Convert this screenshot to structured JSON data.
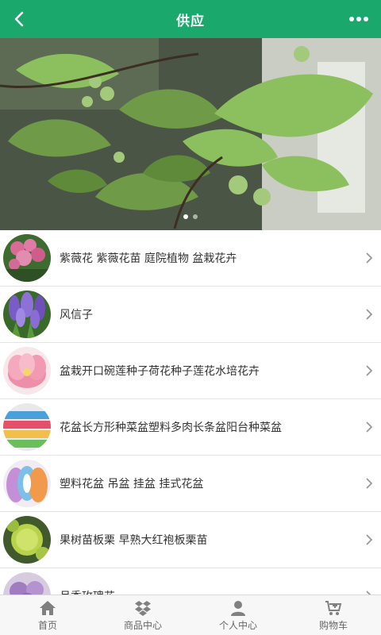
{
  "header": {
    "title": "供应",
    "back_icon": "chevron-left-icon",
    "more_icon": "more-dots-icon"
  },
  "banner": {
    "slide_count": 2,
    "active_slide": 1
  },
  "products": [
    {
      "name": "紫薇花 紫薇花苗 庭院植物 盆栽花卉"
    },
    {
      "name": "风信子"
    },
    {
      "name": "盆栽开口碗莲种子荷花种子莲花水培花卉"
    },
    {
      "name": "花盆长方形种菜盆塑料多肉长条盆阳台种菜盆"
    },
    {
      "name": "塑料花盆 吊盆 挂盆 挂式花盆"
    },
    {
      "name": "果树苗板栗 早熟大红袍板栗苗"
    },
    {
      "name": "月季玫瑰花"
    }
  ],
  "tabbar": [
    {
      "label": "首页",
      "icon": "home-icon"
    },
    {
      "label": "商品中心",
      "icon": "dropbox-icon"
    },
    {
      "label": "个人中心",
      "icon": "user-icon"
    },
    {
      "label": "购物车",
      "icon": "cart-icon"
    }
  ],
  "colors": {
    "header_bg": "#1aa86c",
    "tabbar_icon": "#808080"
  }
}
